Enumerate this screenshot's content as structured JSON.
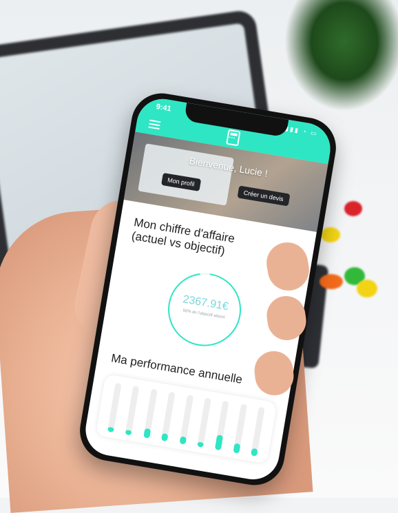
{
  "app": {
    "status_time": "9:41",
    "hero": {
      "welcome": "Bienvenue, Lucie !",
      "profile_button": "Mon profil",
      "quote_button": "Créer un devis"
    },
    "revenue": {
      "title_line1": "Mon chiffre d'affaire",
      "title_line2": "(actuel vs objectif)",
      "value": "2367.91€",
      "subtitle": "50% de l'objectif atteint",
      "progress": 0.95
    },
    "performance": {
      "title": "Ma performance annuelle",
      "bar_levels": [
        0.1,
        0.1,
        0.2,
        0.15,
        0.15,
        0.1,
        0.3,
        0.2,
        0.15
      ]
    }
  },
  "colors": {
    "accent": "#2ee6c4",
    "ring": "#7ad7dc",
    "phone_body": "#111111"
  }
}
